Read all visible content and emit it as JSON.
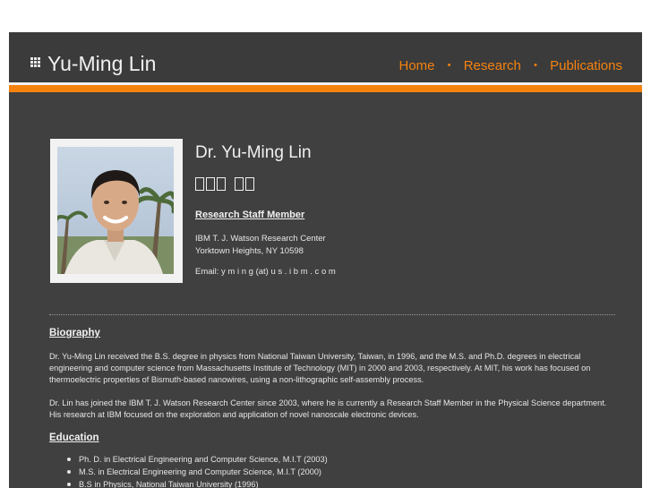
{
  "header": {
    "title": "Yu-Ming Lin",
    "logo_icon": "grid-icon",
    "nav": [
      {
        "label": "Home"
      },
      {
        "label": "Research"
      },
      {
        "label": "Publications"
      }
    ],
    "nav_separator": "•"
  },
  "colors": {
    "accent": "#f5820f",
    "background": "#404040",
    "text": "#f0f0f0"
  },
  "profile": {
    "photo_alt": "portrait-photo",
    "name": "Dr. Yu-Ming Lin",
    "role": "Research Staff Member",
    "address_line1": "IBM T. J. Watson Research Center",
    "address_line2": "Yorktown Heights, NY 10598",
    "email": "Email: y m i n g (at) u s . i b m . c o m"
  },
  "biography": {
    "heading": "Biography",
    "paragraph1": "Dr. Yu-Ming Lin received the B.S. degree in physics from National Taiwan University, Taiwan, in 1996, and the M.S. and Ph.D. degrees in electrical engineering and computer science from Massachusetts Institute of Technology (MIT) in 2000 and 2003, respectively.  At MIT, his work has focused on thermoelectric properties of Bismuth-based nanowires, using a non-lithographic self-assembly process.",
    "paragraph2": "Dr. Lin has joined the IBM T. J. Watson Research Center since 2003, where he is currently a Research Staff Member in the Physical Science department. His research at IBM focused on the exploration and application of novel nanoscale electronic devices."
  },
  "education": {
    "heading": "Education",
    "items": [
      "Ph. D. in Electrical Engineering and Computer Science, M.I.T (2003)",
      "M.S. in Electrical Engineering and Computer Science, M.I.T (2000)",
      "B.S in Physics, National Taiwan University (1996)"
    ]
  }
}
